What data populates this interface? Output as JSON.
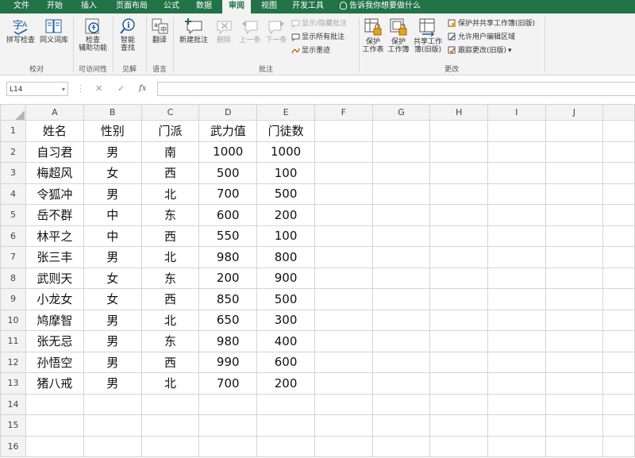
{
  "tabs": [
    "文件",
    "开始",
    "插入",
    "页面布局",
    "公式",
    "数据",
    "审阅",
    "视图",
    "开发工具"
  ],
  "active_tab": "审阅",
  "tell_me": "告诉我你想要做什么",
  "ribbon": {
    "spell_check": "拼写检查",
    "thesaurus": "同义词库",
    "group_proofing": "校对",
    "check_access_1": "检查",
    "check_access_2": "辅助功能",
    "group_access": "可访问性",
    "smart_lookup_1": "智能",
    "smart_lookup_2": "查找",
    "group_insights": "见解",
    "translate": "翻译",
    "group_language": "语言",
    "new_comment": "新建批注",
    "delete": "删除",
    "prev": "上一条",
    "next": "下一条",
    "show_hide": "显示/隐藏批注",
    "show_all": "显示所有批注",
    "show_ink": "显示墨迹",
    "group_comments": "批注",
    "protect_sheet_1": "保护",
    "protect_sheet_2": "工作表",
    "protect_wb_1": "保护",
    "protect_wb_2": "工作簿",
    "share_wb_1": "共享工作",
    "share_wb_2": "簿(旧版)",
    "protect_share": "保护并共享工作簿(旧版)",
    "allow_edit": "允许用户编辑区域",
    "track_changes": "跟踪更改(旧版)",
    "group_changes": "更改"
  },
  "formula_bar": {
    "name_box": "L14",
    "cancel": "✕",
    "enter": "✓",
    "fx": "fx",
    "formula": ""
  },
  "columns": [
    "A",
    "B",
    "C",
    "D",
    "E",
    "F",
    "G",
    "H",
    "I",
    "J"
  ],
  "rows": [
    [
      "姓名",
      "性别",
      "门派",
      "武力值",
      "门徒数"
    ],
    [
      "自习君",
      "男",
      "南",
      "1000",
      "1000"
    ],
    [
      "梅超风",
      "女",
      "西",
      "500",
      "100"
    ],
    [
      "令狐冲",
      "男",
      "北",
      "700",
      "500"
    ],
    [
      "岳不群",
      "中",
      "东",
      "600",
      "200"
    ],
    [
      "林平之",
      "中",
      "西",
      "550",
      "100"
    ],
    [
      "张三丰",
      "男",
      "北",
      "980",
      "800"
    ],
    [
      "武则天",
      "女",
      "东",
      "200",
      "900"
    ],
    [
      "小龙女",
      "女",
      "西",
      "850",
      "500"
    ],
    [
      "鸠摩智",
      "男",
      "北",
      "650",
      "300"
    ],
    [
      "张无忌",
      "男",
      "东",
      "980",
      "400"
    ],
    [
      "孙悟空",
      "男",
      "西",
      "990",
      "600"
    ],
    [
      "猪八戒",
      "男",
      "北",
      "700",
      "200"
    ],
    [
      "",
      "",
      "",
      "",
      ""
    ],
    [
      "",
      "",
      "",
      "",
      ""
    ],
    [
      "",
      "",
      "",
      "",
      ""
    ]
  ]
}
